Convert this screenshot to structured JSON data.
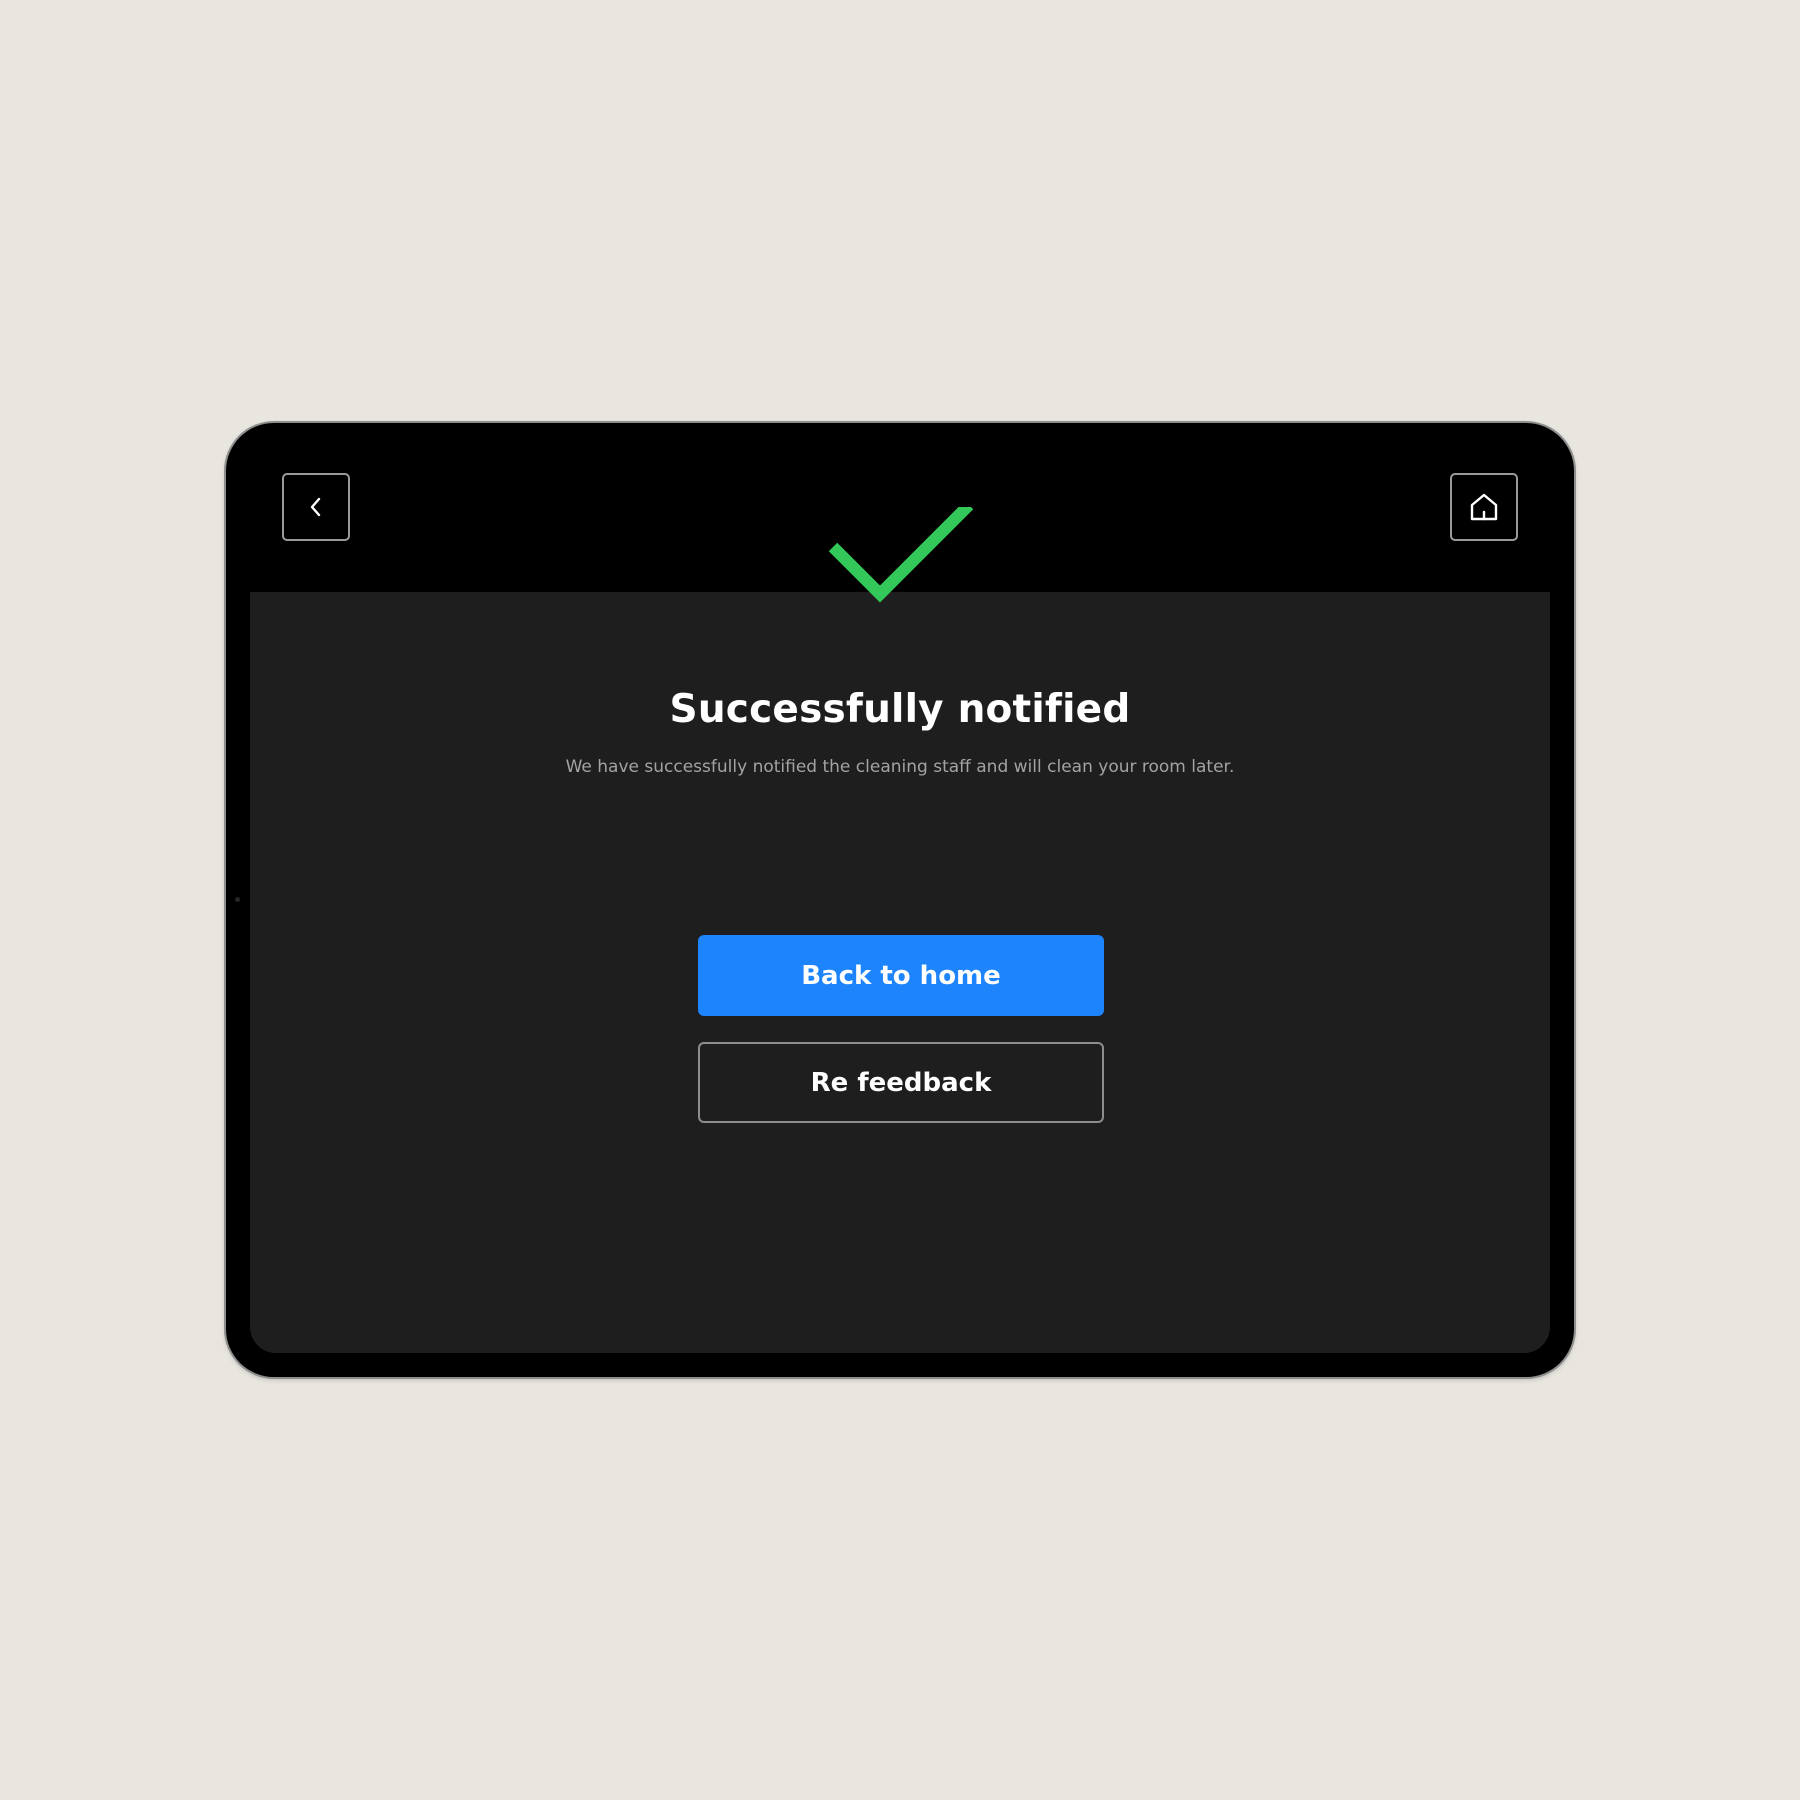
{
  "header": {
    "back_icon": "chevron-left-icon",
    "home_icon": "home-icon"
  },
  "status": {
    "icon": "checkmark-icon",
    "icon_color": "#34C759",
    "title": "Successfully notified",
    "message": "We have successfully notified the cleaning staff and will clean your room later."
  },
  "actions": {
    "primary_label": "Back to home",
    "primary_color": "#1E84FC",
    "secondary_label": "Re feedback"
  },
  "theme": {
    "page_background": "#E9E6DF",
    "screen_background": "#1E1E1E",
    "topbar_background": "#000000"
  }
}
